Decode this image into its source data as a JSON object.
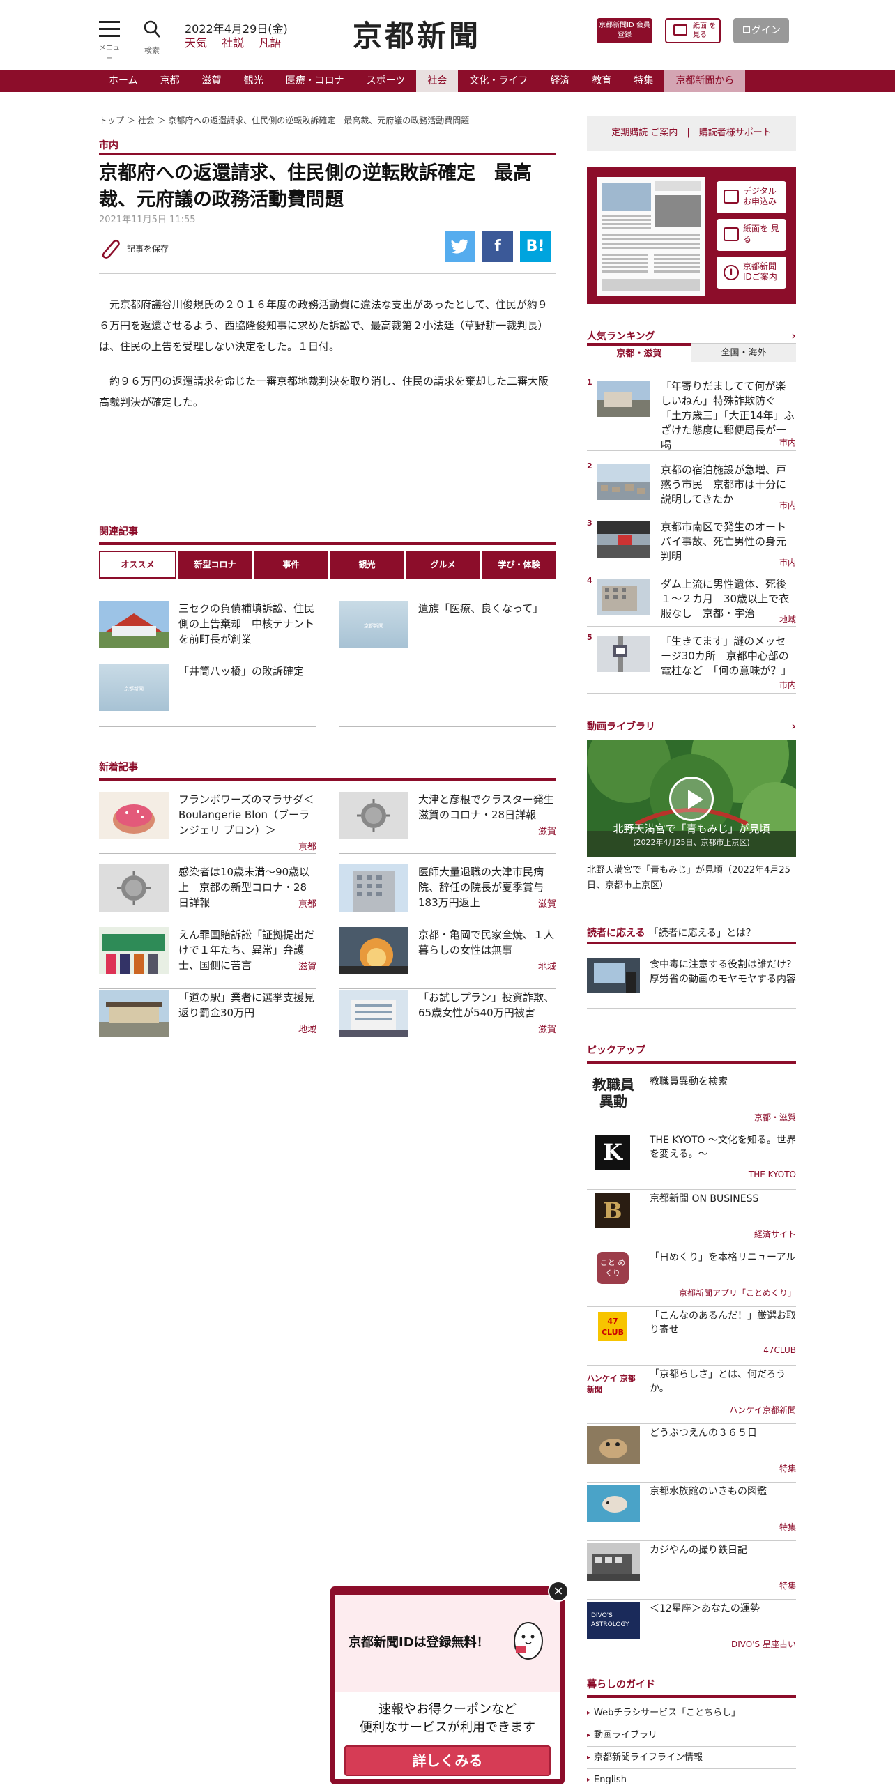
{
  "header": {
    "menu_label": "メニュー",
    "search_label": "検索",
    "date": "2022年4月29日(金)",
    "links": [
      "天気",
      "社説",
      "凡語"
    ],
    "logo": "京都新聞",
    "id_button": "京都新聞ID 会員登録",
    "paper_button": "紙面 を見る",
    "login_button": "ログイン"
  },
  "nav": {
    "items": [
      "ホーム",
      "京都",
      "滋賀",
      "観光",
      "医療・コロナ",
      "スポーツ",
      "社会",
      "文化・ライフ",
      "経済",
      "教育",
      "特集",
      "京都新聞から"
    ],
    "active": "社会"
  },
  "article": {
    "breadcrumb": "トップ ＞ 社会 ＞ 京都府への返還請求、住民側の逆転敗訴確定　最高裁、元府議の政務活動費問題",
    "category": "市内",
    "title": "京都府への返還請求、住民側の逆転敗訴確定　最高裁、元府議の政務活動費問題",
    "date": "2021年11月5日 11:55",
    "save_label": "記事を保存",
    "share": {
      "twitter": "t",
      "facebook": "f",
      "hatena": "B!"
    },
    "paragraphs": [
      "元京都府議谷川俊規氏の２０１６年度の政務活動費に違法な支出があったとして、住民が約９６万円を返還させるよう、西脇隆俊知事に求めた訴訟で、最高裁第２小法廷（草野耕一裁判長）は、住民の上告を受理しない決定をした。１日付。",
      "約９６万円の返還請求を命じた一審京都地裁判決を取り消し、住民の請求を棄却した二審大阪高裁判決が確定した。"
    ]
  },
  "related": {
    "heading": "関連記事",
    "tabs": [
      "オススメ",
      "新型コロナ",
      "事件",
      "観光",
      "グルメ",
      "学び・体験"
    ],
    "items": [
      {
        "title": "三セクの負債補填訴訟、住民側の上告棄却　中核テナントを前町長が創業",
        "tag": ""
      },
      {
        "title": "遺族「医療、良くなって」",
        "tag": ""
      },
      {
        "title": "「井筒八ッ橋」の敗訴確定",
        "tag": ""
      }
    ],
    "placeholder_logo": "京都新聞"
  },
  "new_articles": {
    "heading": "新着記事",
    "items": [
      {
        "title": "フランボワーズのマラサダ＜Boulangerie Blon（ブーランジェリ ブロン）＞",
        "tag": "京都"
      },
      {
        "title": "大津と彦根でクラスター発生　滋賀のコロナ・28日詳報",
        "tag": "滋賀"
      },
      {
        "title": "感染者は10歳未満～90歳以上　京都の新型コロナ・28日詳報",
        "tag": "京都"
      },
      {
        "title": "医師大量退職の大津市民病院、辞任の院長が夏季賞与183万円返上",
        "tag": "滋賀"
      },
      {
        "title": "えん罪国賠訴訟「証拠提出だけで１年たち、異常」弁護士、国側に苦言",
        "tag": "滋賀"
      },
      {
        "title": "京都・亀岡で民家全焼、１人暮らしの女性は無事",
        "tag": "地域"
      },
      {
        "title": "「道の駅」業者に選挙支援見返り罰金30万円",
        "tag": "地域"
      },
      {
        "title": "「お試しプラン」投資詐欺、65歳女性が540万円被害",
        "tag": "滋賀"
      }
    ]
  },
  "sidebar": {
    "subscribe": "定期購読 ご案内　|　購読者様サポート",
    "paper_buttons": [
      "デジタル お申込み",
      "紙面を 見る",
      "京都新聞 IDご案内"
    ],
    "ranking": {
      "heading": "人気ランキング",
      "tabs": [
        "京都・滋賀",
        "全国・海外"
      ],
      "items": [
        {
          "num": "1",
          "title": "「年寄りだましてて何が楽しいねん」特殊詐欺防ぐ「土方歳三」「大正14年」ふざけた態度に郵便局長が一喝",
          "tag": "市内"
        },
        {
          "num": "2",
          "title": "京都の宿泊施設が急増、戸惑う市民　京都市は十分に説明してきたか",
          "tag": "市内"
        },
        {
          "num": "3",
          "title": "京都市南区で発生のオートバイ事故、死亡男性の身元判明",
          "tag": "市内"
        },
        {
          "num": "4",
          "title": "ダム上流に男性遺体、死後１～２カ月　30歳以上で衣服なし　京都・宇治",
          "tag": "地域"
        },
        {
          "num": "5",
          "title": "「生きてます」謎のメッセージ30カ所　京都中心部の電柱など　「何の意味が？」",
          "tag": "市内"
        }
      ]
    },
    "video": {
      "heading": "動画ライブラリ",
      "overlay": "北野天満宮で「青もみじ」が見頃",
      "overlay_sub": "(2022年4月25日、京都市上京区)",
      "caption": "北野天満宮で「青もみじ」が見頃（2022年4月25日、京都市上京区）"
    },
    "reader": {
      "heading": "読者に応える",
      "heading_sub": "「読者に応える」とは？",
      "title": "食中毒に注意する役割は誰だけ？　厚労省の動画のモヤモヤする内容"
    },
    "pickup": {
      "heading": "ピックアップ",
      "items": [
        {
          "logo": "教職員異動",
          "title": "教職員異動を検索",
          "tag": "京都・滋賀"
        },
        {
          "logo": "K",
          "title": "THE KYOTO ～文化を知る。世界を変える。～",
          "tag": "THE KYOTO"
        },
        {
          "logo": "B",
          "title": "京都新聞 ON BUSINESS",
          "tag": "経済サイト"
        },
        {
          "logo": "こと めくり",
          "title": "「日めくり」を本格リニューアル",
          "tag": "京都新聞アプリ「ことめくり」"
        },
        {
          "logo": "47 CLUB",
          "title": "「こんなのあるんだ！」厳選お取り寄せ",
          "tag": "47CLUB"
        },
        {
          "logo": "ハンケイ 京都新聞",
          "title": "「京都らしさ」とは、何だろうか。",
          "tag": "ハンケイ京都新聞"
        },
        {
          "logo": "",
          "title": "どうぶつえんの３６５日",
          "tag": "特集"
        },
        {
          "logo": "",
          "title": "京都水族館のいきもの図鑑",
          "tag": "特集"
        },
        {
          "logo": "",
          "title": "カジやんの撮り鉄日記",
          "tag": "特集"
        },
        {
          "logo": "DIVO'S ASTROLOGY",
          "title": "＜12星座＞あなたの運勢",
          "tag": "DIVO'S 星座占い"
        }
      ]
    },
    "guide": {
      "heading": "暮らしのガイド",
      "items": [
        "Webチラシサービス「ことちらし」",
        "動画ライブラリ",
        "京都新聞ライフライン情報",
        "English"
      ]
    }
  },
  "popup": {
    "title": "京都新聞IDは登録無料！",
    "desc_line1": "速報やお得クーポンなど",
    "desc_line2": "便利なサービスが利用できます",
    "button": "詳しくみる",
    "close": "×"
  },
  "colors": {
    "brand": "#8c0d2a",
    "twitter": "#55acee",
    "facebook": "#3b5998",
    "hatena": "#00a4de"
  }
}
